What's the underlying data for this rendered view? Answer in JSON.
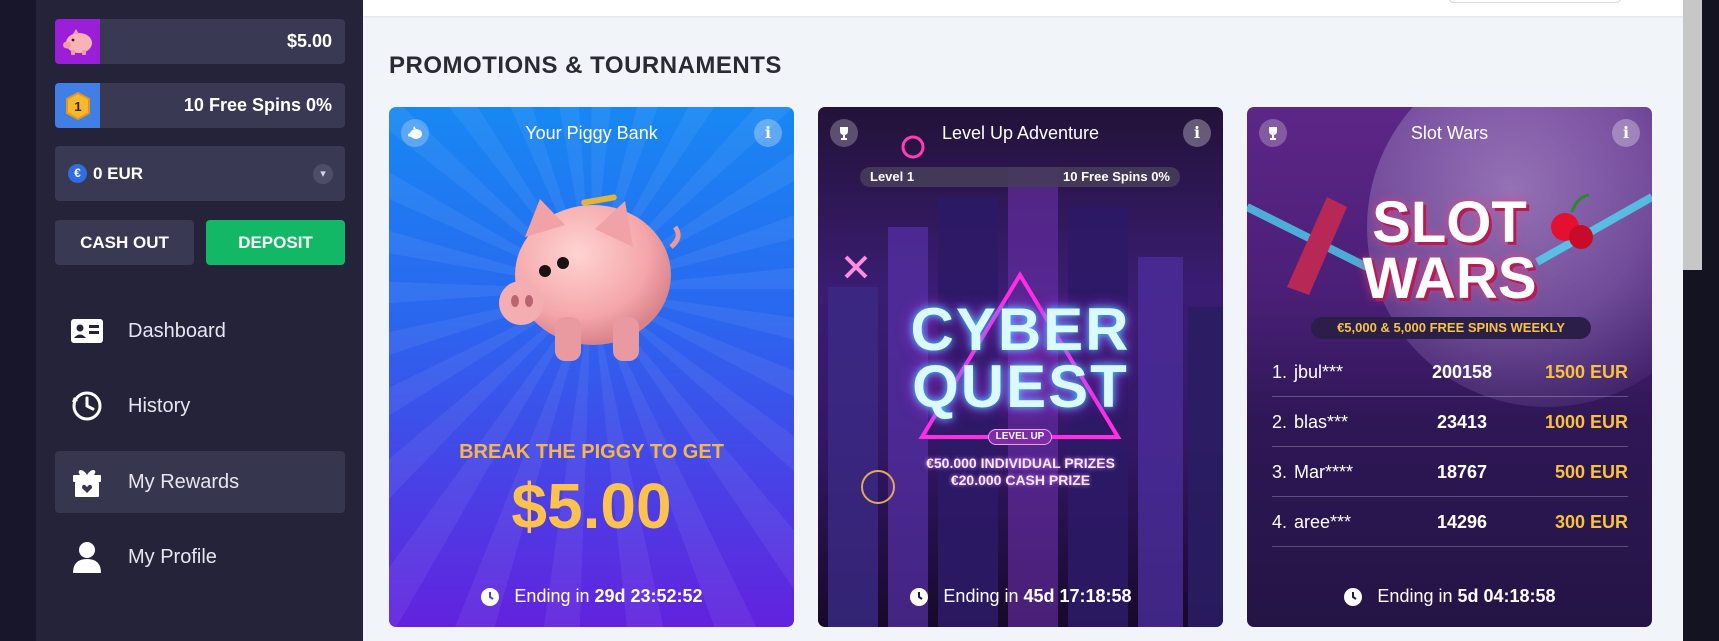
{
  "sidebar": {
    "piggy_balance": "$5.00",
    "level_badge": "1",
    "free_spins": "10 Free Spins 0%",
    "currency_symbol": "€",
    "currency_value": "0 EUR",
    "cash_out_label": "CASH OUT",
    "deposit_label": "DEPOSIT",
    "nav": [
      {
        "label": "Dashboard",
        "icon": "dashboard-icon"
      },
      {
        "label": "History",
        "icon": "history-icon"
      },
      {
        "label": "My Rewards",
        "icon": "gift-icon",
        "active": true
      },
      {
        "label": "My Profile",
        "icon": "profile-icon"
      }
    ]
  },
  "main": {
    "section_title": "PROMOTIONS & TOURNAMENTS"
  },
  "cards": {
    "piggy": {
      "title": "Your Piggy Bank",
      "break_text": "BREAK THE PIGGY TO GET",
      "amount": "$5.00",
      "ending_prefix": "Ending in",
      "ending_time": "29d 23:52:52"
    },
    "cyber": {
      "title": "Level Up Adventure",
      "level": "Level 1",
      "spins": "10 Free Spins 0%",
      "logo_line1": "CYBER",
      "logo_line2": "QUEST",
      "level_up": "LEVEL UP",
      "prize_line1": "€50.000 INDIVIDUAL PRIZES",
      "prize_line2": "€20.000 CASH PRIZE",
      "ending_prefix": "Ending in",
      "ending_time": "45d 17:18:58"
    },
    "slot": {
      "title": "Slot Wars",
      "logo_line1": "SLOT",
      "logo_line2": "WARS",
      "weekly": "€5,000 & 5,000 FREE SPINS WEEKLY",
      "leaderboard": [
        {
          "rank": "1.",
          "name": "jbul***",
          "score": "200158",
          "prize": "1500 EUR"
        },
        {
          "rank": "2.",
          "name": "blas***",
          "score": "23413",
          "prize": "1000 EUR"
        },
        {
          "rank": "3.",
          "name": "Mar****",
          "score": "18767",
          "prize": "500 EUR"
        },
        {
          "rank": "4.",
          "name": "aree***",
          "score": "14296",
          "prize": "300 EUR"
        }
      ],
      "ending_prefix": "Ending in",
      "ending_time": "5d 04:18:58"
    }
  },
  "colors": {
    "deposit_green": "#12b865",
    "sidebar_bg": "#24233a",
    "gold": "#fcc24d"
  }
}
